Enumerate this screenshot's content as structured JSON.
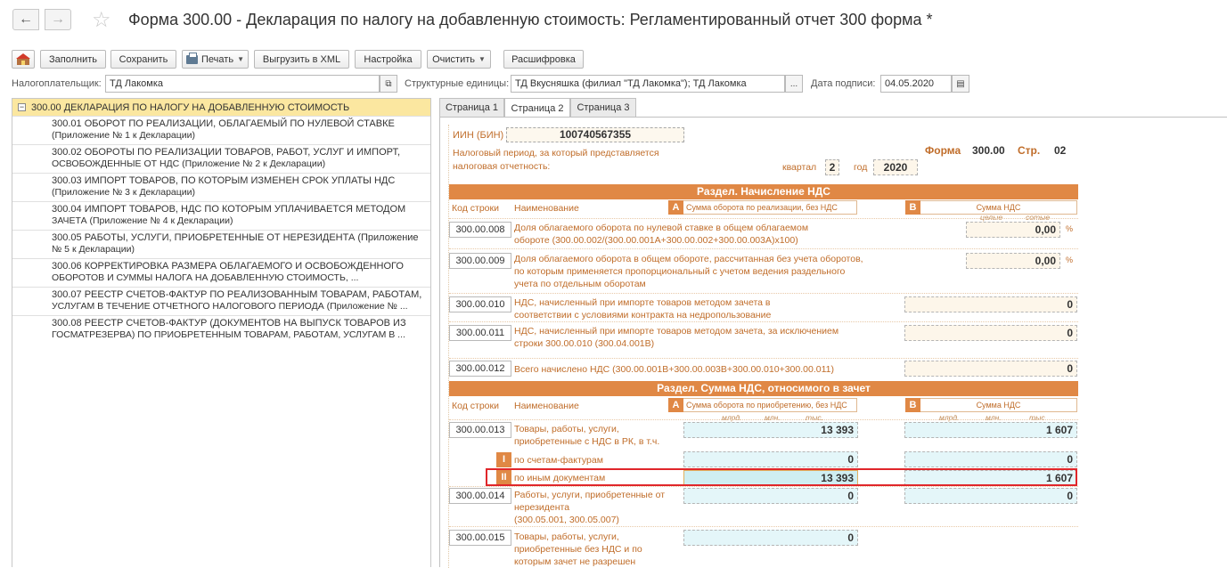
{
  "window": {
    "title": "Форма 300.00 - Декларация по налогу на добавленную стоимость: Регламентированный отчет 300 форма *"
  },
  "toolbar": {
    "fill": "Заполнить",
    "save": "Сохранить",
    "print": "Печать",
    "export_xml": "Выгрузить в XML",
    "settings": "Настройка",
    "clear": "Очистить",
    "decode": "Расшифровка"
  },
  "fields": {
    "taxpayer_label": "Налогоплательщик:",
    "taxpayer_value": "ТД Лакомка",
    "units_label": "Структурные единицы:",
    "units_value": "ТД Вкусняшка (филиал \"ТД Лакомка\"); ТД Лакомка",
    "sign_date_label": "Дата подписи:",
    "sign_date_value": "04.05.2020"
  },
  "tree": {
    "root": "300.00 ДЕКЛАРАЦИЯ ПО НАЛОГУ НА ДОБАВЛЕННУЮ СТОИМОСТЬ",
    "items": [
      {
        "line1": "300.01 ОБОРОТ ПО РЕАЛИЗАЦИИ, ОБЛАГАЕМЫЙ ПО НУЛЕВОЙ СТАВКЕ",
        "line2": "(Приложение № 1 к Декларации)"
      },
      {
        "line1": "300.02 ОБОРОТЫ ПО  РЕАЛИЗАЦИИ ТОВАРОВ, РАБОТ, УСЛУГ И ИМПОРТ,",
        "line2": "ОСВОБОЖДЕННЫЕ ОТ НДС (Приложение № 2 к Декларации)"
      },
      {
        "line1": "300.03 ИМПОРТ ТОВАРОВ, ПО КОТОРЫМ ИЗМЕНЕН СРОК УПЛАТЫ НДС",
        "line2": "(Приложение № 3 к Декларации)"
      },
      {
        "line1": "300.04 ИМПОРТ ТОВАРОВ, НДС ПО КОТОРЫМ УПЛАЧИВАЕТСЯ МЕТОДОМ",
        "line2": "ЗАЧЕТА (Приложение № 4 к Декларации)"
      },
      {
        "line1": "300.05 РАБОТЫ, УСЛУГИ, ПРИОБРЕТЕННЫЕ ОТ НЕРЕЗИДЕНТА (Приложение",
        "line2": "№ 5 к Декларации)"
      },
      {
        "line1": "300.06 КОРРЕКТИРОВКА РАЗМЕРА ОБЛАГАЕМОГО И ОСВОБОЖДЕННОГО",
        "line2": "ОБОРОТОВ И СУММЫ НАЛОГА НА ДОБАВЛЕННУЮ СТОИМОСТЬ, ..."
      },
      {
        "line1": "300.07 РЕЕСТР СЧЕТОВ-ФАКТУР ПО РЕАЛИЗОВАННЫМ ТОВАРАМ, РАБОТАМ,",
        "line2": "УСЛУГАМ В ТЕЧЕНИЕ ОТЧЕТНОГО НАЛОГОВОГО ПЕРИОДА (Приложение № ..."
      },
      {
        "line1": "300.08 РЕЕСТР СЧЕТОВ-ФАКТУР (ДОКУМЕНТОВ НА ВЫПУСК ТОВАРОВ ИЗ",
        "line2": "ГОСМАТРЕЗЕРВА) ПО ПРИОБРЕТЕННЫМ ТОВАРАМ, РАБОТАМ, УСЛУГАМ В ..."
      }
    ]
  },
  "tabs": [
    "Страница 1",
    "Страница 2",
    "Страница 3"
  ],
  "form": {
    "iin_label": "ИИН (БИН)",
    "iin_value": "100740567355",
    "period_label_1": "Налоговый период, за который представляется",
    "period_label_2": "налоговая отчетность:",
    "quarter_label": "квартал",
    "quarter_value": "2",
    "year_label": "год",
    "year_value": "2020",
    "form_label": "Форма",
    "form_value": "300.00",
    "page_label": "Стр.",
    "page_value": "02",
    "section1": "Раздел. Начисление НДС",
    "section2": "Раздел. Сумма НДС, относимого в зачет",
    "code_hdr": "Код строки",
    "name_hdr": "Наименование",
    "col_a": "A",
    "col_b": "B",
    "col_a_hdr1": "Сумма оборота по реализации, без НДС",
    "col_b_hdr1": "Сумма НДС",
    "col_a_hdr2": "Сумма оборота по приобретению, без НДС",
    "col_b_hdr2": "Сумма НДС",
    "whole": "целые",
    "hundredths": "сотые",
    "bln": "млрд.",
    "mln": "млн.",
    "ths": "тыс.",
    "pct": "%",
    "rom1": "I",
    "rom2": "II",
    "rows": {
      "r008": {
        "code": "300.00.008",
        "l1": "Доля облагаемого оборота по нулевой ставке в общем облагаемом",
        "l2": "обороте (300.00.002/(300.00.001А+300.00.002+300.00.003А)x100)",
        "b": "0,00"
      },
      "r009": {
        "code": "300.00.009",
        "l1": "Доля облагаемого оборота в общем обороте, рассчитанная без учета оборотов,",
        "l2": "по которым применяется пропорциональный с учетом ведения раздельного",
        "l3": "учета по отдельным оборотам",
        "b": "0,00"
      },
      "r010": {
        "code": "300.00.010",
        "l1": "НДС, начисленный при импорте товаров методом зачета в",
        "l2": "соответствии с условиями контракта на недропользование",
        "b": "0"
      },
      "r011": {
        "code": "300.00.011",
        "l1": "НДС, начисленный при импорте товаров методом зачета, за исключением",
        "l2": "строки 300.00.010 (300.04.001В)",
        "b": "0"
      },
      "r012": {
        "code": "300.00.012",
        "l1": "Всего начислено НДС (300.00.001В+300.00.003В+300.00.010+300.00.011)",
        "b": "0"
      },
      "r013": {
        "code": "300.00.013",
        "l1": "Товары, работы, услуги,",
        "l2": "приобретенные с НДС в РК, в т.ч.",
        "a": "13 393",
        "b": "1 607"
      },
      "r013_1": {
        "l1": "по счетам-фактурам",
        "a": "0",
        "b": "0"
      },
      "r013_2": {
        "l1": "по иным документам",
        "a": "13 393",
        "b": "1 607"
      },
      "r014": {
        "code": "300.00.014",
        "l1": "Работы, услуги, приобретенные от",
        "l2": "нерезидента",
        "l3": "(300.05.001, 300.05.007)",
        "a": "0",
        "b": "0"
      },
      "r015": {
        "code": "300.00.015",
        "l1": "Товары, работы, услуги,",
        "l2": "приобретенные без НДС и по",
        "l3": "которым зачет не разрешен",
        "a": "0"
      }
    }
  }
}
